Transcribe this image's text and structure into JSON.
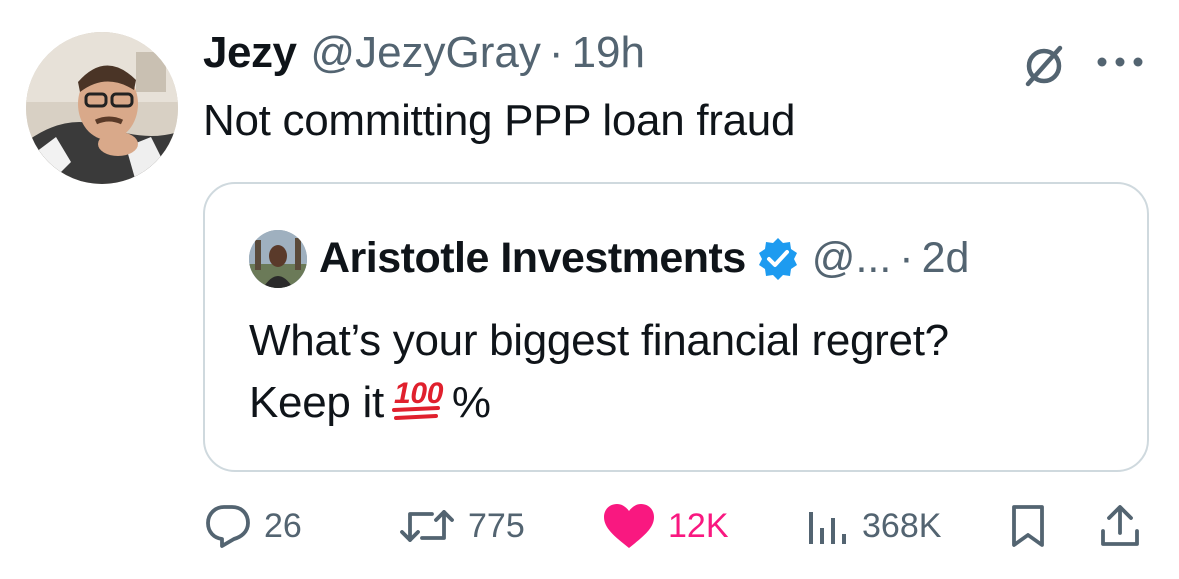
{
  "tweet": {
    "author_name": "Jezy",
    "handle": "@JezyGray",
    "separator": "·",
    "time": "19h",
    "text": "Not committing PPP loan fraud"
  },
  "quote": {
    "author_name": "Aristotle Investments",
    "handle": "@...",
    "separator": "·",
    "time": "2d",
    "line1": "What’s your biggest financial regret?",
    "line2_prefix": "Keep it",
    "line2_suffix": "%",
    "emoji": "hundred-points-emoji"
  },
  "actions": {
    "replies": "26",
    "reposts": "775",
    "likes": "12K",
    "views": "368K"
  },
  "icons": [
    "grok-icon",
    "more-icon",
    "verified-badge-icon",
    "reply-icon",
    "repost-icon",
    "like-icon",
    "views-icon",
    "bookmark-icon",
    "share-icon"
  ],
  "colors": {
    "text": "#0f1419",
    "secondary": "#536471",
    "like": "#f91880",
    "verified": "#1d9bf0",
    "border": "#cfd9de"
  }
}
